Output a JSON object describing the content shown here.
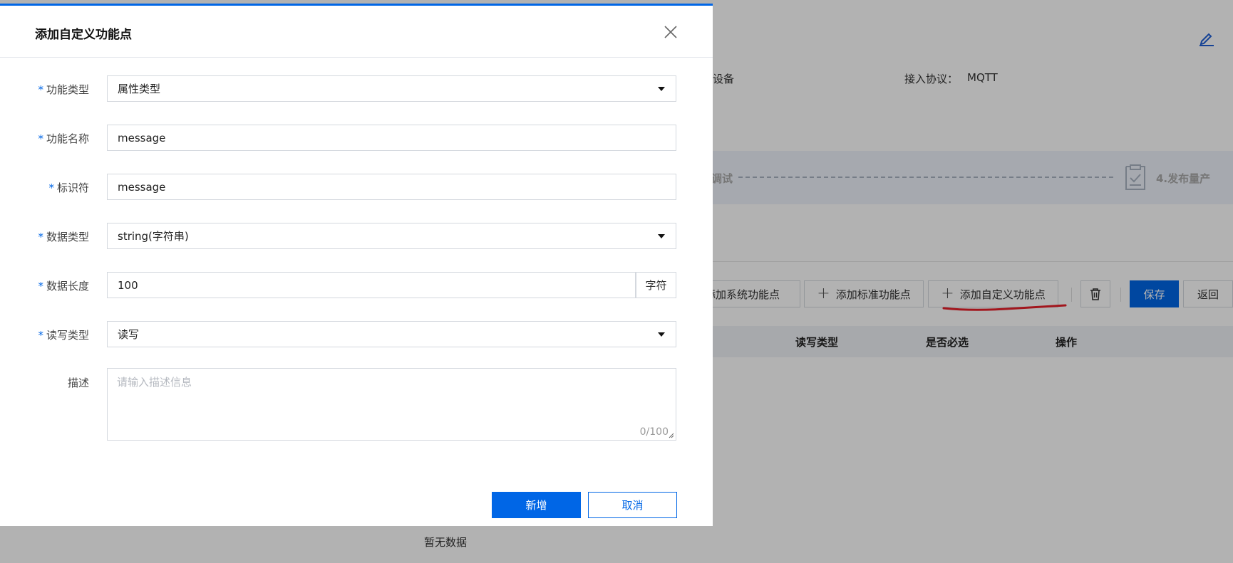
{
  "background": {
    "device_label_fragment": "设备",
    "protocol_label": "接入协议：",
    "protocol_value": "MQTT",
    "steps": {
      "step3_fragment": "调试",
      "step4_label": "4.发布量产"
    },
    "toolbar": {
      "add_system_label": "添加系统功能点",
      "add_standard_label": "添加标准功能点",
      "add_custom_label": "添加自定义功能点",
      "save_label": "保存",
      "back_label": "返回"
    },
    "table": {
      "headers": [
        "读写类型",
        "是否必选",
        "操作"
      ],
      "empty_text": "暂无数据"
    }
  },
  "modal": {
    "title": "添加自定义功能点",
    "fields": {
      "func_type": {
        "label": "功能类型",
        "value": "属性类型"
      },
      "func_name": {
        "label": "功能名称",
        "value": "message"
      },
      "identifier": {
        "label": "标识符",
        "value": "message"
      },
      "data_type": {
        "label": "数据类型",
        "value": "string(字符串)"
      },
      "data_length": {
        "label": "数据长度",
        "value": "100",
        "unit": "字符"
      },
      "rw_type": {
        "label": "读写类型",
        "value": "读写"
      },
      "description": {
        "label": "描述",
        "placeholder": "请输入描述信息",
        "counter": "0/100"
      }
    },
    "required_mark": "*",
    "submit_label": "新增",
    "cancel_label": "取消"
  },
  "colors": {
    "primary": "#0066e6",
    "annotation_red": "#e8202a"
  }
}
